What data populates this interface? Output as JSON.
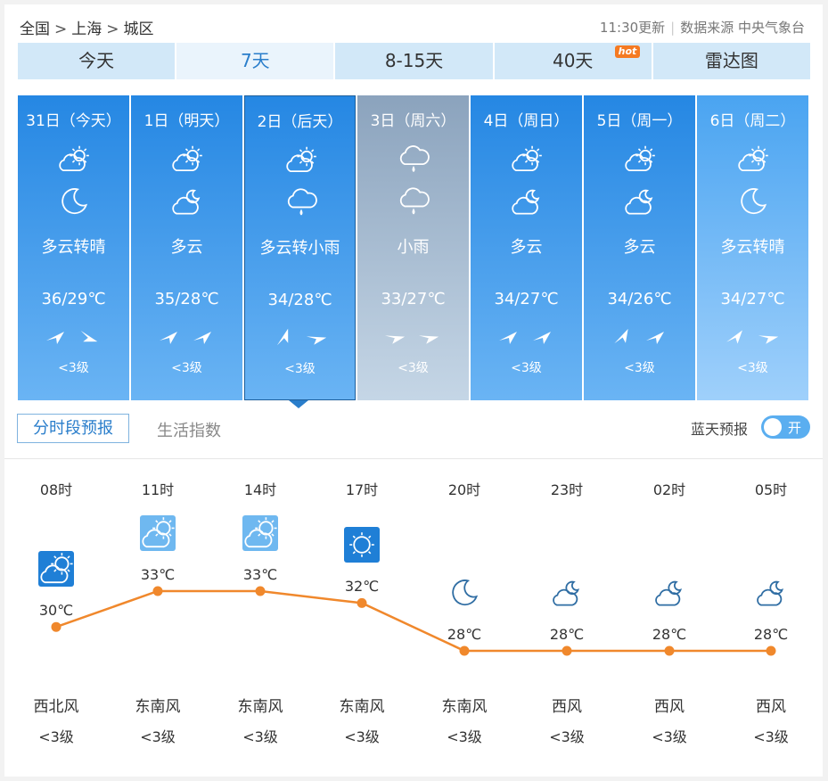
{
  "breadcrumb": [
    "全国",
    "上海",
    "城区"
  ],
  "breadcrumb_sep": ">",
  "meta": {
    "update_time": "11:30更新",
    "source": "数据来源 中央气象台"
  },
  "tabs": [
    {
      "label": "今天",
      "active": false
    },
    {
      "label": "7天",
      "active": true
    },
    {
      "label": "8-15天",
      "active": false
    },
    {
      "label": "40天",
      "active": false,
      "badge": "hot"
    },
    {
      "label": "雷达图",
      "active": false
    }
  ],
  "days": [
    {
      "date": "31日（今天）",
      "day_icon": "partly-cloudy-icon",
      "night_icon": "moon-icon",
      "desc": "多云转晴",
      "temp": "36/29℃",
      "wind_icons": [
        "wind-arrow-icon",
        "wind-arrow-icon"
      ],
      "level": "<3级",
      "rainy": false,
      "selected": false
    },
    {
      "date": "1日（明天）",
      "day_icon": "partly-cloudy-icon",
      "night_icon": "cloudy-night-icon",
      "desc": "多云",
      "temp": "35/28℃",
      "wind_icons": [
        "wind-arrow-icon",
        "wind-arrow-icon"
      ],
      "level": "<3级",
      "rainy": false,
      "selected": false
    },
    {
      "date": "2日（后天）",
      "day_icon": "partly-cloudy-icon",
      "night_icon": "light-rain-icon",
      "desc": "多云转小雨",
      "temp": "34/28℃",
      "wind_icons": [
        "wind-arrow-icon",
        "wind-arrow-icon"
      ],
      "level": "<3级",
      "rainy": false,
      "selected": true
    },
    {
      "date": "3日（周六）",
      "day_icon": "light-rain-icon",
      "night_icon": "light-rain-icon",
      "desc": "小雨",
      "temp": "33/27℃",
      "wind_icons": [
        "wind-arrow-icon",
        "wind-arrow-icon"
      ],
      "level": "<3级",
      "rainy": true,
      "selected": false
    },
    {
      "date": "4日（周日）",
      "day_icon": "partly-cloudy-icon",
      "night_icon": "cloudy-night-icon",
      "desc": "多云",
      "temp": "34/27℃",
      "wind_icons": [
        "wind-arrow-icon",
        "wind-arrow-icon"
      ],
      "level": "<3级",
      "rainy": false,
      "selected": false
    },
    {
      "date": "5日（周一）",
      "day_icon": "partly-cloudy-icon",
      "night_icon": "cloudy-night-icon",
      "desc": "多云",
      "temp": "34/26℃",
      "wind_icons": [
        "wind-arrow-icon",
        "wind-arrow-icon"
      ],
      "level": "<3级",
      "rainy": false,
      "selected": false
    },
    {
      "date": "6日（周二）",
      "day_icon": "partly-cloudy-icon",
      "night_icon": "moon-icon",
      "desc": "多云转晴",
      "temp": "34/27℃",
      "wind_icons": [
        "wind-arrow-icon",
        "wind-arrow-icon"
      ],
      "level": "<3级",
      "rainy": false,
      "selected": false
    }
  ],
  "subtabs": {
    "hourly": "分时段预报",
    "life": "生活指数"
  },
  "bluesky": {
    "label": "蓝天预报",
    "toggle_text": "开"
  },
  "colors": {
    "accent": "#2a7ecb",
    "line": "#f0882c",
    "tab_bg": "#d2e8f8",
    "hot_badge": "#f57a22"
  },
  "chart_data": {
    "type": "line",
    "categories": [
      "08时",
      "11时",
      "14时",
      "17时",
      "20时",
      "23时",
      "02时",
      "05时"
    ],
    "temps": [
      30,
      33,
      33,
      32,
      28,
      28,
      28,
      28
    ],
    "temp_labels": [
      "30℃",
      "33℃",
      "33℃",
      "32℃",
      "28℃",
      "28℃",
      "28℃",
      "28℃"
    ],
    "icons": [
      "partly-cloudy-icon",
      "partly-cloudy-icon",
      "partly-cloudy-icon",
      "sunny-icon",
      "moon-icon",
      "cloudy-night-icon",
      "cloudy-night-icon",
      "cloudy-night-icon"
    ],
    "wind_dirs": [
      "西北风",
      "东南风",
      "东南风",
      "东南风",
      "东南风",
      "西风",
      "西风",
      "西风"
    ],
    "wind_levels": [
      "<3级",
      "<3级",
      "<3级",
      "<3级",
      "<3级",
      "<3级",
      "<3级",
      "<3级"
    ]
  }
}
